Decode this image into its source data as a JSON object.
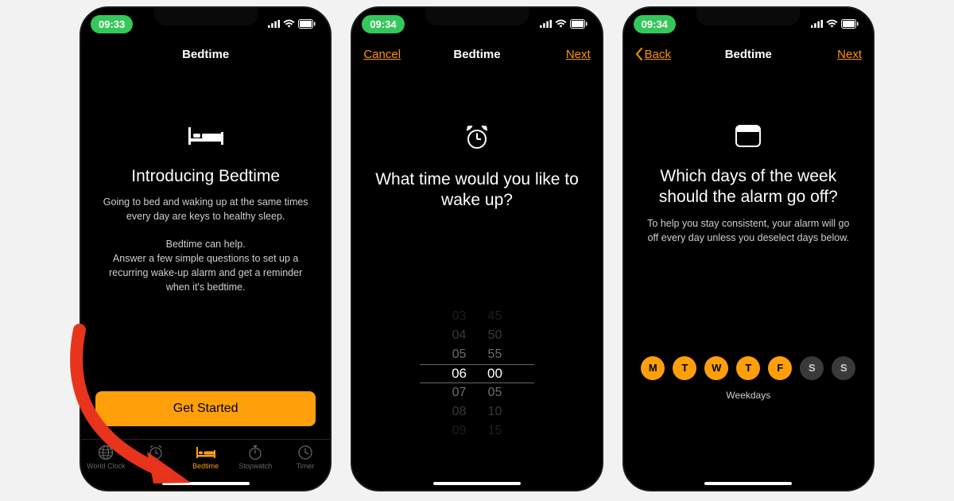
{
  "status": {
    "time1": "09:33",
    "time2": "09:34",
    "time3": "09:34"
  },
  "s1": {
    "title": "Bedtime",
    "headline": "Introducing Bedtime",
    "desc1": "Going to bed and waking up at the same times every day are keys to healthy sleep.",
    "desc2a": "Bedtime can help.",
    "desc2b": "Answer a few simple questions to set up a recurring wake-up alarm and get a reminder when it's bedtime.",
    "cta": "Get Started",
    "tabs": {
      "worldclock": "World Clock",
      "alarm": "Alarm",
      "bedtime": "Bedtime",
      "stopwatch": "Stopwatch",
      "timer": "Timer"
    }
  },
  "s2": {
    "title": "Bedtime",
    "cancel": "Cancel",
    "next": "Next",
    "headline": "What time would you like to wake up?",
    "picker": {
      "h": [
        "03",
        "04",
        "05",
        "06",
        "07",
        "08",
        "09"
      ],
      "m": [
        "45",
        "50",
        "55",
        "00",
        "05",
        "10",
        "15"
      ],
      "selected_index": 3
    }
  },
  "s3": {
    "title": "Bedtime",
    "back": "Back",
    "next": "Next",
    "headline": "Which days of the week should the alarm go off?",
    "desc": "To help you stay consistent, your alarm will go off every day unless you deselect days below.",
    "days": [
      {
        "l": "M",
        "on": true
      },
      {
        "l": "T",
        "on": true
      },
      {
        "l": "W",
        "on": true
      },
      {
        "l": "T",
        "on": true
      },
      {
        "l": "F",
        "on": true
      },
      {
        "l": "S",
        "on": false
      },
      {
        "l": "S",
        "on": false
      }
    ],
    "week_label": "Weekdays"
  }
}
